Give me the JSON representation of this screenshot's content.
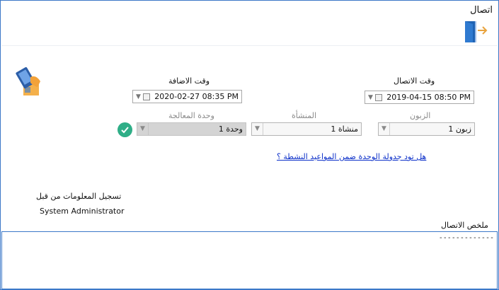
{
  "window": {
    "title": "اتصال"
  },
  "toolbar": {
    "exit_icon": "exit-door-icon"
  },
  "header_icon": "phone-hand-icon",
  "call_time": {
    "label": "وقت الاتصال",
    "value": "2019-04-15 08:50 PM"
  },
  "added_time": {
    "label": "وقت الاضافة",
    "value": "2020-02-27 08:35 PM"
  },
  "customer": {
    "label": "الزبون",
    "value": "زبون 1"
  },
  "facility": {
    "label": "المنشأة",
    "value": "منشاة 1"
  },
  "processing_unit": {
    "label": "وحدة المعالجة",
    "value": "وحدة 1"
  },
  "schedule_link": "هل تود جدولة الوحدة ضمن المواعيد النشطة ؟",
  "registered_by": {
    "label": "تسجيل المعلومات من قبل",
    "value": "System Administrator"
  },
  "summary": {
    "label": "ملخص الاتصال",
    "value": "-------------"
  },
  "colors": {
    "accent": "#3b78c8",
    "check": "#2fae87",
    "link": "#0b2fc9",
    "exit_arrow": "#e8a33d"
  }
}
